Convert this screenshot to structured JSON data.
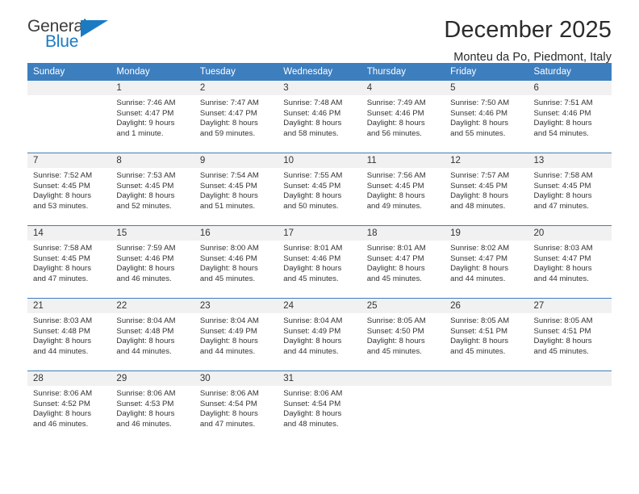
{
  "brand": {
    "name_top": "General",
    "name_bottom": "Blue",
    "accent_color": "#1a7bc4",
    "triangle_icon": "triangle-icon"
  },
  "header": {
    "title": "December 2025",
    "subtitle": "Monteu da Po, Piedmont, Italy"
  },
  "calendar": {
    "header_bg": "#3d7ebf",
    "daynum_bg": "#f1f1f1",
    "weekdays": [
      "Sunday",
      "Monday",
      "Tuesday",
      "Wednesday",
      "Thursday",
      "Friday",
      "Saturday"
    ],
    "weeks": [
      [
        {
          "day": "",
          "sunrise": "",
          "sunset": "",
          "daylight_line1": "",
          "daylight_line2": ""
        },
        {
          "day": "1",
          "sunrise": "Sunrise: 7:46 AM",
          "sunset": "Sunset: 4:47 PM",
          "daylight_line1": "Daylight: 9 hours",
          "daylight_line2": "and 1 minute."
        },
        {
          "day": "2",
          "sunrise": "Sunrise: 7:47 AM",
          "sunset": "Sunset: 4:47 PM",
          "daylight_line1": "Daylight: 8 hours",
          "daylight_line2": "and 59 minutes."
        },
        {
          "day": "3",
          "sunrise": "Sunrise: 7:48 AM",
          "sunset": "Sunset: 4:46 PM",
          "daylight_line1": "Daylight: 8 hours",
          "daylight_line2": "and 58 minutes."
        },
        {
          "day": "4",
          "sunrise": "Sunrise: 7:49 AM",
          "sunset": "Sunset: 4:46 PM",
          "daylight_line1": "Daylight: 8 hours",
          "daylight_line2": "and 56 minutes."
        },
        {
          "day": "5",
          "sunrise": "Sunrise: 7:50 AM",
          "sunset": "Sunset: 4:46 PM",
          "daylight_line1": "Daylight: 8 hours",
          "daylight_line2": "and 55 minutes."
        },
        {
          "day": "6",
          "sunrise": "Sunrise: 7:51 AM",
          "sunset": "Sunset: 4:46 PM",
          "daylight_line1": "Daylight: 8 hours",
          "daylight_line2": "and 54 minutes."
        }
      ],
      [
        {
          "day": "7",
          "sunrise": "Sunrise: 7:52 AM",
          "sunset": "Sunset: 4:45 PM",
          "daylight_line1": "Daylight: 8 hours",
          "daylight_line2": "and 53 minutes."
        },
        {
          "day": "8",
          "sunrise": "Sunrise: 7:53 AM",
          "sunset": "Sunset: 4:45 PM",
          "daylight_line1": "Daylight: 8 hours",
          "daylight_line2": "and 52 minutes."
        },
        {
          "day": "9",
          "sunrise": "Sunrise: 7:54 AM",
          "sunset": "Sunset: 4:45 PM",
          "daylight_line1": "Daylight: 8 hours",
          "daylight_line2": "and 51 minutes."
        },
        {
          "day": "10",
          "sunrise": "Sunrise: 7:55 AM",
          "sunset": "Sunset: 4:45 PM",
          "daylight_line1": "Daylight: 8 hours",
          "daylight_line2": "and 50 minutes."
        },
        {
          "day": "11",
          "sunrise": "Sunrise: 7:56 AM",
          "sunset": "Sunset: 4:45 PM",
          "daylight_line1": "Daylight: 8 hours",
          "daylight_line2": "and 49 minutes."
        },
        {
          "day": "12",
          "sunrise": "Sunrise: 7:57 AM",
          "sunset": "Sunset: 4:45 PM",
          "daylight_line1": "Daylight: 8 hours",
          "daylight_line2": "and 48 minutes."
        },
        {
          "day": "13",
          "sunrise": "Sunrise: 7:58 AM",
          "sunset": "Sunset: 4:45 PM",
          "daylight_line1": "Daylight: 8 hours",
          "daylight_line2": "and 47 minutes."
        }
      ],
      [
        {
          "day": "14",
          "sunrise": "Sunrise: 7:58 AM",
          "sunset": "Sunset: 4:45 PM",
          "daylight_line1": "Daylight: 8 hours",
          "daylight_line2": "and 47 minutes."
        },
        {
          "day": "15",
          "sunrise": "Sunrise: 7:59 AM",
          "sunset": "Sunset: 4:46 PM",
          "daylight_line1": "Daylight: 8 hours",
          "daylight_line2": "and 46 minutes."
        },
        {
          "day": "16",
          "sunrise": "Sunrise: 8:00 AM",
          "sunset": "Sunset: 4:46 PM",
          "daylight_line1": "Daylight: 8 hours",
          "daylight_line2": "and 45 minutes."
        },
        {
          "day": "17",
          "sunrise": "Sunrise: 8:01 AM",
          "sunset": "Sunset: 4:46 PM",
          "daylight_line1": "Daylight: 8 hours",
          "daylight_line2": "and 45 minutes."
        },
        {
          "day": "18",
          "sunrise": "Sunrise: 8:01 AM",
          "sunset": "Sunset: 4:47 PM",
          "daylight_line1": "Daylight: 8 hours",
          "daylight_line2": "and 45 minutes."
        },
        {
          "day": "19",
          "sunrise": "Sunrise: 8:02 AM",
          "sunset": "Sunset: 4:47 PM",
          "daylight_line1": "Daylight: 8 hours",
          "daylight_line2": "and 44 minutes."
        },
        {
          "day": "20",
          "sunrise": "Sunrise: 8:03 AM",
          "sunset": "Sunset: 4:47 PM",
          "daylight_line1": "Daylight: 8 hours",
          "daylight_line2": "and 44 minutes."
        }
      ],
      [
        {
          "day": "21",
          "sunrise": "Sunrise: 8:03 AM",
          "sunset": "Sunset: 4:48 PM",
          "daylight_line1": "Daylight: 8 hours",
          "daylight_line2": "and 44 minutes."
        },
        {
          "day": "22",
          "sunrise": "Sunrise: 8:04 AM",
          "sunset": "Sunset: 4:48 PM",
          "daylight_line1": "Daylight: 8 hours",
          "daylight_line2": "and 44 minutes."
        },
        {
          "day": "23",
          "sunrise": "Sunrise: 8:04 AM",
          "sunset": "Sunset: 4:49 PM",
          "daylight_line1": "Daylight: 8 hours",
          "daylight_line2": "and 44 minutes."
        },
        {
          "day": "24",
          "sunrise": "Sunrise: 8:04 AM",
          "sunset": "Sunset: 4:49 PM",
          "daylight_line1": "Daylight: 8 hours",
          "daylight_line2": "and 44 minutes."
        },
        {
          "day": "25",
          "sunrise": "Sunrise: 8:05 AM",
          "sunset": "Sunset: 4:50 PM",
          "daylight_line1": "Daylight: 8 hours",
          "daylight_line2": "and 45 minutes."
        },
        {
          "day": "26",
          "sunrise": "Sunrise: 8:05 AM",
          "sunset": "Sunset: 4:51 PM",
          "daylight_line1": "Daylight: 8 hours",
          "daylight_line2": "and 45 minutes."
        },
        {
          "day": "27",
          "sunrise": "Sunrise: 8:05 AM",
          "sunset": "Sunset: 4:51 PM",
          "daylight_line1": "Daylight: 8 hours",
          "daylight_line2": "and 45 minutes."
        }
      ],
      [
        {
          "day": "28",
          "sunrise": "Sunrise: 8:06 AM",
          "sunset": "Sunset: 4:52 PM",
          "daylight_line1": "Daylight: 8 hours",
          "daylight_line2": "and 46 minutes."
        },
        {
          "day": "29",
          "sunrise": "Sunrise: 8:06 AM",
          "sunset": "Sunset: 4:53 PM",
          "daylight_line1": "Daylight: 8 hours",
          "daylight_line2": "and 46 minutes."
        },
        {
          "day": "30",
          "sunrise": "Sunrise: 8:06 AM",
          "sunset": "Sunset: 4:54 PM",
          "daylight_line1": "Daylight: 8 hours",
          "daylight_line2": "and 47 minutes."
        },
        {
          "day": "31",
          "sunrise": "Sunrise: 8:06 AM",
          "sunset": "Sunset: 4:54 PM",
          "daylight_line1": "Daylight: 8 hours",
          "daylight_line2": "and 48 minutes."
        },
        {
          "day": "",
          "sunrise": "",
          "sunset": "",
          "daylight_line1": "",
          "daylight_line2": ""
        },
        {
          "day": "",
          "sunrise": "",
          "sunset": "",
          "daylight_line1": "",
          "daylight_line2": ""
        },
        {
          "day": "",
          "sunrise": "",
          "sunset": "",
          "daylight_line1": "",
          "daylight_line2": ""
        }
      ]
    ]
  }
}
